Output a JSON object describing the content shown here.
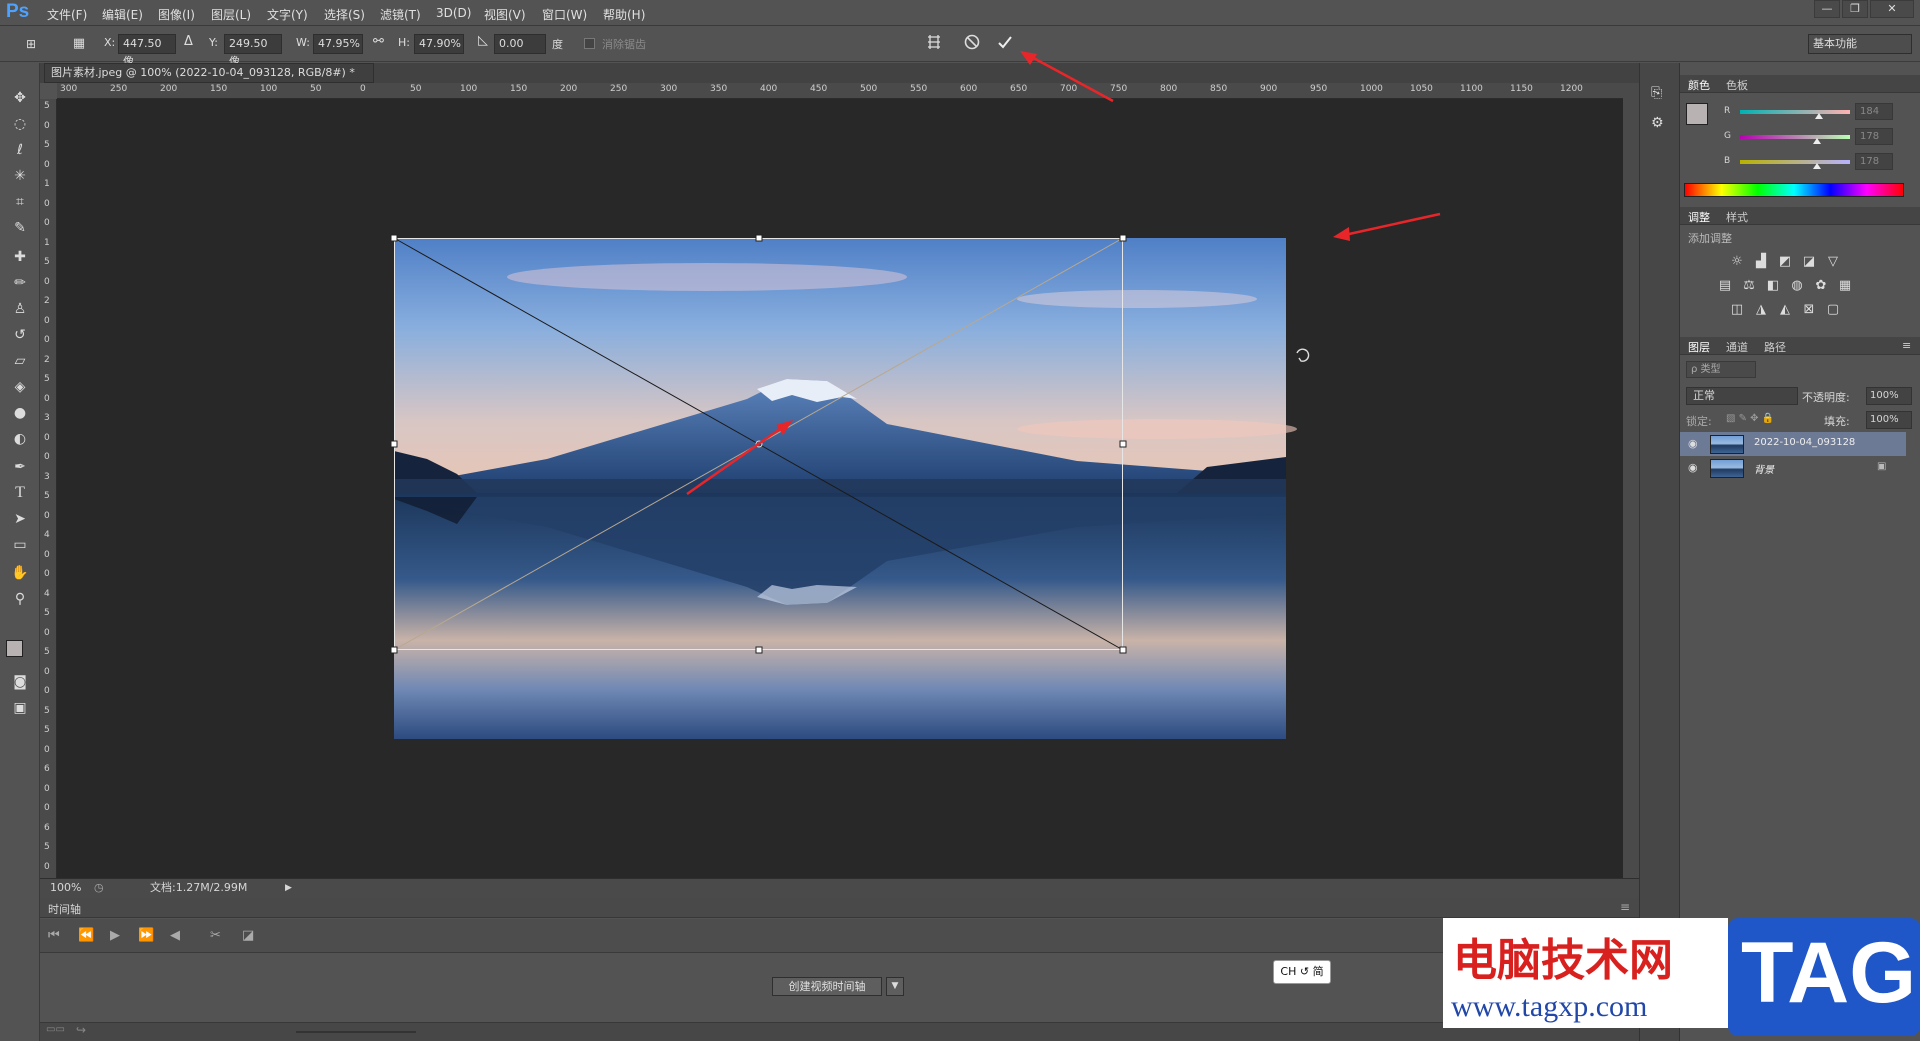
{
  "app": {
    "logo": "Ps"
  },
  "menu": [
    "文件(F)",
    "编辑(E)",
    "图像(I)",
    "图层(L)",
    "文字(Y)",
    "选择(S)",
    "滤镜(T)",
    "3D(D)",
    "视图(V)",
    "窗口(W)",
    "帮助(H)"
  ],
  "window_controls": {
    "minimize": "—",
    "restore": "❐",
    "close": "✕"
  },
  "options": {
    "x_label": "X:",
    "x_value": "447.50 像",
    "y_label": "Y:",
    "y_value": "249.50 像",
    "w_label": "W:",
    "w_value": "47.95%",
    "h_label": "H:",
    "h_value": "47.90%",
    "angle_value": "0.00",
    "angle_unit": "度",
    "interp_label": "消除锯齿",
    "workspace": "基本功能"
  },
  "document": {
    "tab_title": "图片素材.jpeg @ 100% (2022-10-04_093128, RGB/8#) *",
    "zoom": "100%",
    "doc_size": "文档:1.27M/2.99M"
  },
  "ruler": {
    "h_ticks": [
      "300",
      "250",
      "200",
      "150",
      "100",
      "50",
      "0",
      "50",
      "100",
      "150",
      "200",
      "250",
      "300",
      "350",
      "400",
      "450",
      "500",
      "550",
      "600",
      "650",
      "700",
      "750",
      "800",
      "850",
      "900",
      "950",
      "1000",
      "1050",
      "1100",
      "1150",
      "1200"
    ],
    "v_ticks": [
      "5",
      "0",
      "5",
      "0",
      "1",
      "0",
      "0",
      "1",
      "5",
      "0",
      "2",
      "0",
      "0",
      "2",
      "5",
      "0",
      "3",
      "0",
      "0",
      "3",
      "5",
      "0",
      "4",
      "0",
      "0",
      "4",
      "5",
      "0",
      "5",
      "0",
      "0",
      "5",
      "5",
      "0",
      "6",
      "0",
      "0",
      "6",
      "5",
      "0"
    ]
  },
  "timeline": {
    "title": "时间轴",
    "create_button": "创建视频时间轴"
  },
  "ime": {
    "label": "CH ↺ 简"
  },
  "panels": {
    "color": {
      "tabs": [
        "颜色",
        "色板"
      ],
      "channels": [
        {
          "name": "R",
          "value": "184",
          "level": 0.72
        },
        {
          "name": "G",
          "value": "178",
          "level": 0.7
        },
        {
          "name": "B",
          "value": "178",
          "level": 0.7
        }
      ]
    },
    "adjustments": {
      "tabs": [
        "调整",
        "样式"
      ],
      "subtitle": "添加调整"
    },
    "layers": {
      "tabs": [
        "图层",
        "通道",
        "路径"
      ],
      "filter": "ρ 类型",
      "blend_mode": "正常",
      "opacity_label": "不透明度:",
      "opacity": "100%",
      "lock_label": "锁定:",
      "fill_label": "填充:",
      "fill": "100%",
      "items": [
        {
          "name": "2022-10-04_093128",
          "selected": true
        },
        {
          "name": "背景",
          "selected": false,
          "locked": true
        }
      ]
    }
  },
  "watermark": {
    "title": "电脑技术网",
    "url": "www.tagxp.com",
    "tag": "TAG"
  },
  "colors": {
    "accent": "#4da2ff",
    "annotation": "#e8262a",
    "selected_layer": "#6c7a96"
  }
}
